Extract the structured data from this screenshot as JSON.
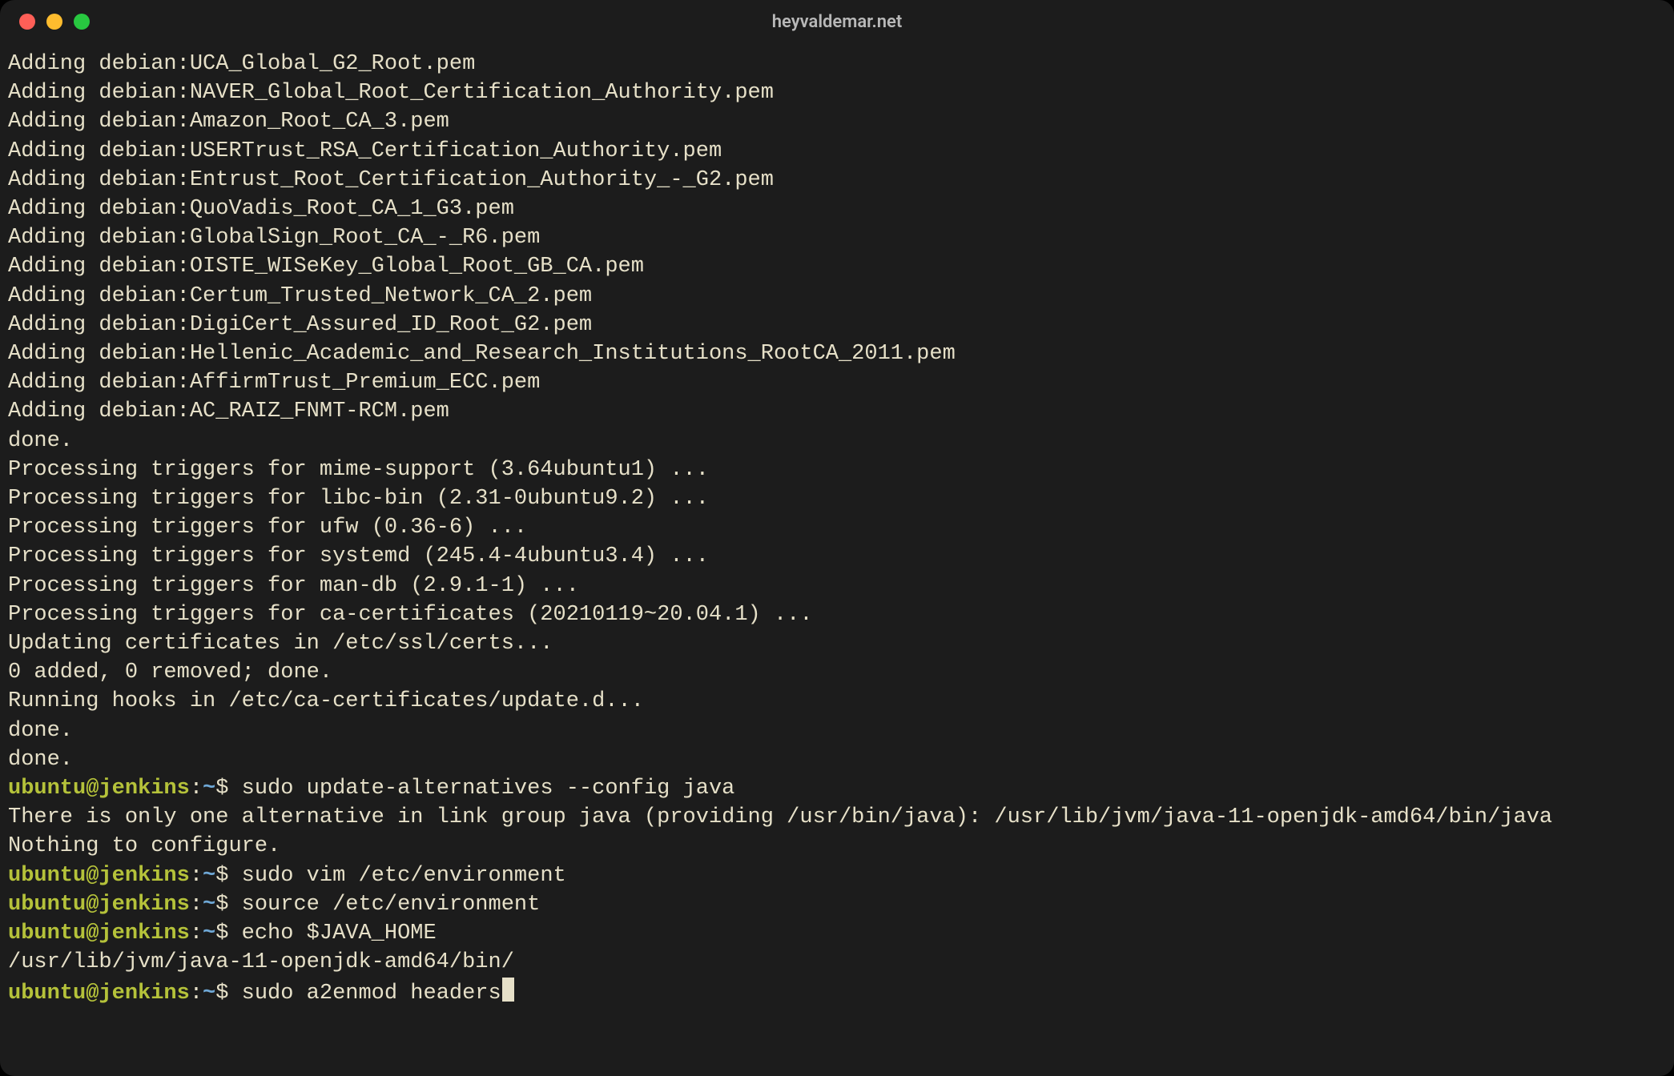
{
  "window": {
    "title": "heyvaldemar.net"
  },
  "prompt": {
    "user": "ubuntu",
    "at": "@",
    "host": "jenkins",
    "colon": ":",
    "path": "~",
    "dollar": "$ "
  },
  "output_top": [
    "Adding debian:UCA_Global_G2_Root.pem",
    "Adding debian:NAVER_Global_Root_Certification_Authority.pem",
    "Adding debian:Amazon_Root_CA_3.pem",
    "Adding debian:USERTrust_RSA_Certification_Authority.pem",
    "Adding debian:Entrust_Root_Certification_Authority_-_G2.pem",
    "Adding debian:QuoVadis_Root_CA_1_G3.pem",
    "Adding debian:GlobalSign_Root_CA_-_R6.pem",
    "Adding debian:OISTE_WISeKey_Global_Root_GB_CA.pem",
    "Adding debian:Certum_Trusted_Network_CA_2.pem",
    "Adding debian:DigiCert_Assured_ID_Root_G2.pem",
    "Adding debian:Hellenic_Academic_and_Research_Institutions_RootCA_2011.pem",
    "Adding debian:AffirmTrust_Premium_ECC.pem",
    "Adding debian:AC_RAIZ_FNMT-RCM.pem",
    "done.",
    "Processing triggers for mime-support (3.64ubuntu1) ...",
    "Processing triggers for libc-bin (2.31-0ubuntu9.2) ...",
    "Processing triggers for ufw (0.36-6) ...",
    "Processing triggers for systemd (245.4-4ubuntu3.4) ...",
    "Processing triggers for man-db (2.9.1-1) ...",
    "Processing triggers for ca-certificates (20210119~20.04.1) ...",
    "Updating certificates in /etc/ssl/certs...",
    "0 added, 0 removed; done.",
    "Running hooks in /etc/ca-certificates/update.d...",
    "",
    "done.",
    "done."
  ],
  "entries": [
    {
      "command": "sudo update-alternatives --config java",
      "output": [
        "There is only one alternative in link group java (providing /usr/bin/java): /usr/lib/jvm/java-11-openjdk-amd64/bin/java",
        "Nothing to configure."
      ]
    },
    {
      "command": "sudo vim /etc/environment",
      "output": []
    },
    {
      "command": "source /etc/environment",
      "output": []
    },
    {
      "command": "echo $JAVA_HOME",
      "output": [
        "/usr/lib/jvm/java-11-openjdk-amd64/bin/"
      ]
    }
  ],
  "current_command": "sudo a2enmod headers"
}
